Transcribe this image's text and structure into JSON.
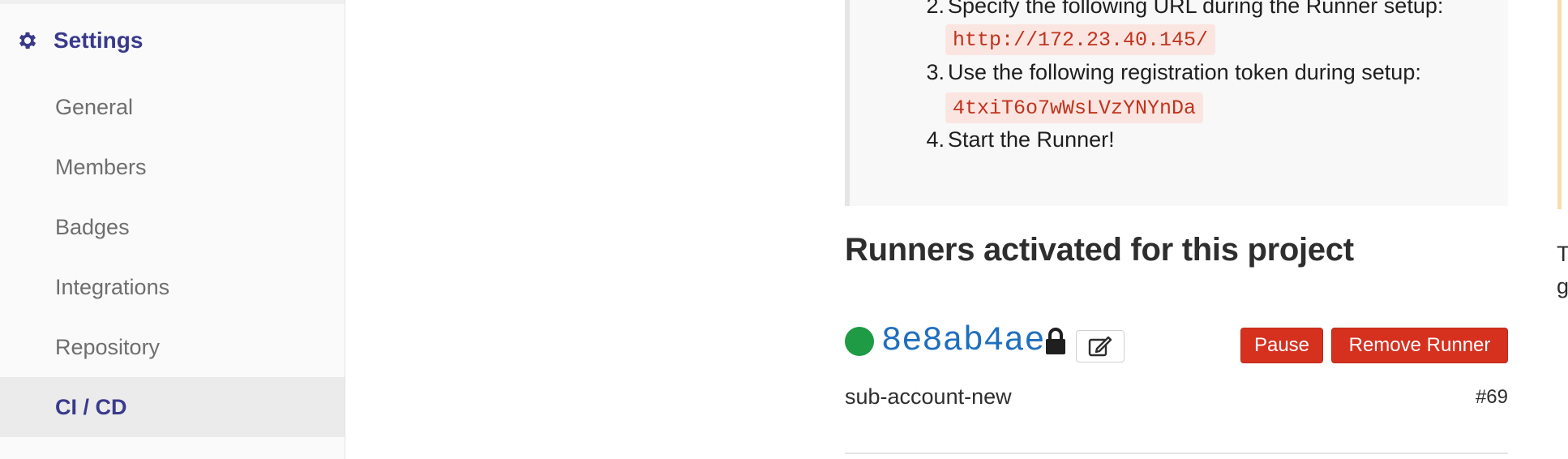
{
  "sidebar": {
    "header": "Settings",
    "header_icon": "gear-icon",
    "items": [
      {
        "label": "General",
        "active": false
      },
      {
        "label": "Members",
        "active": false
      },
      {
        "label": "Badges",
        "active": false
      },
      {
        "label": "Integrations",
        "active": false
      },
      {
        "label": "Repository",
        "active": false
      },
      {
        "label": "CI / CD",
        "active": true
      }
    ]
  },
  "instructions": {
    "steps": [
      {
        "num": "2.",
        "text": "Specify the following URL during the Runner setup:",
        "code": "http://172.23.40.145/"
      },
      {
        "num": "3.",
        "text": "Use the following registration token during setup:",
        "code": "4txiT6o7wWsLVzYNYnDa"
      },
      {
        "num": "4.",
        "text": "Start the Runner!"
      }
    ]
  },
  "runners_section": {
    "title": "Runners activated for this project",
    "runner": {
      "status": "online",
      "status_color": "#1f9a45",
      "id": "8e8ab4ae",
      "description": "sub-account-new",
      "number": "#69",
      "locked_icon": "lock-icon",
      "edit_icon": "edit-icon",
      "pause_label": "Pause",
      "remove_label": "Remove Runner"
    }
  },
  "right_panel": {
    "line1": "T",
    "line2": "g"
  },
  "colors": {
    "brand_nav": "#3a3a8c",
    "danger": "#d6301f",
    "link": "#1f6fbf",
    "code_text": "#c0341d",
    "code_bg": "#fbe5e1"
  }
}
